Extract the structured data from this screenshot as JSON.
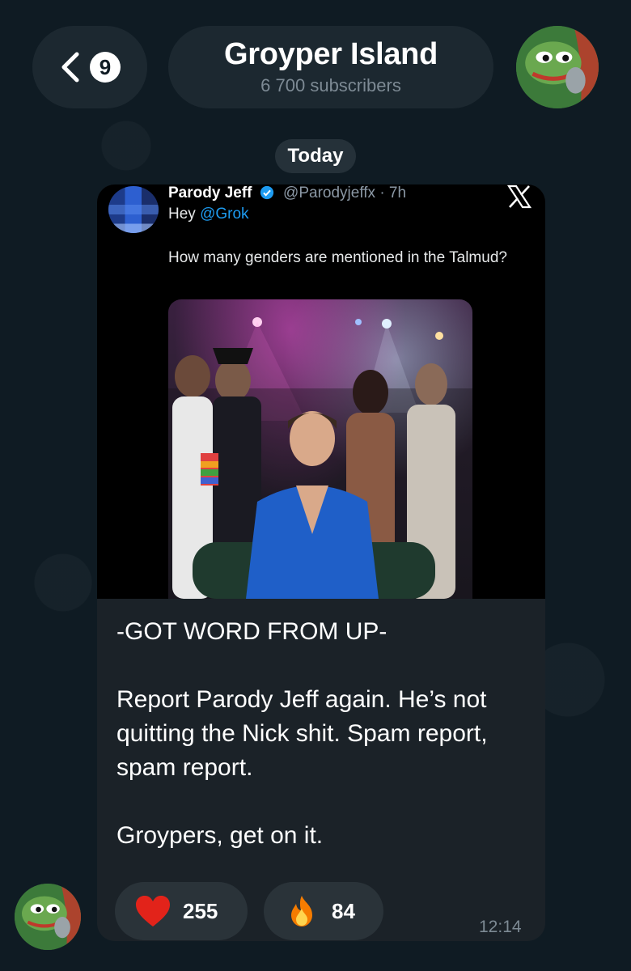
{
  "header": {
    "unread_count": "9",
    "title": "Groyper Island",
    "subtitle": "6 700 subscribers"
  },
  "date_chip": "Today",
  "tweet": {
    "author_name": "Parody Jeff",
    "author_handle": "@Parodyjeffx · 7h",
    "reply_prefix": "Hey ",
    "reply_mention": "@Grok",
    "text": "How many genders are mentioned in the Talmud?"
  },
  "message": {
    "paragraphs": [
      "-GOT WORD FROM UP-",
      "Report Parody Jeff again. He’s not quitting the Nick shit. Spam report, spam report.",
      "Groypers, get on it."
    ],
    "time": "12:14"
  },
  "reactions": [
    {
      "icon": "heart-icon",
      "count": "255",
      "color": "#e2231a"
    },
    {
      "icon": "fire-icon",
      "count": "84",
      "color": "#f57c00"
    }
  ],
  "colors": {
    "background": "#0f1b23",
    "bubble": "#1b2228",
    "link": "#1d9bf0"
  }
}
